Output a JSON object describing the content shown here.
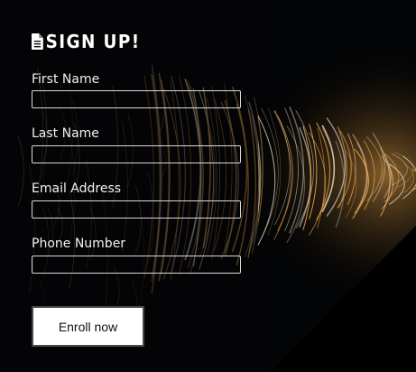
{
  "form": {
    "title": "SIGN UP!",
    "title_icon": "document-icon",
    "fields": [
      {
        "label": "First Name",
        "value": "",
        "placeholder": ""
      },
      {
        "label": "Last Name",
        "value": "",
        "placeholder": ""
      },
      {
        "label": "Email Address",
        "value": "",
        "placeholder": ""
      },
      {
        "label": "Phone Number",
        "value": "",
        "placeholder": ""
      }
    ],
    "submit_label": "Enroll now"
  },
  "colors": {
    "background": "#030405",
    "text": "#ffffff",
    "input_border": "#d9d9d9",
    "button_background": "#ffffff",
    "button_border": "#4a4a4a",
    "light_streak_warm": "#f0a84a",
    "light_streak_cool": "#d8d0c0"
  }
}
